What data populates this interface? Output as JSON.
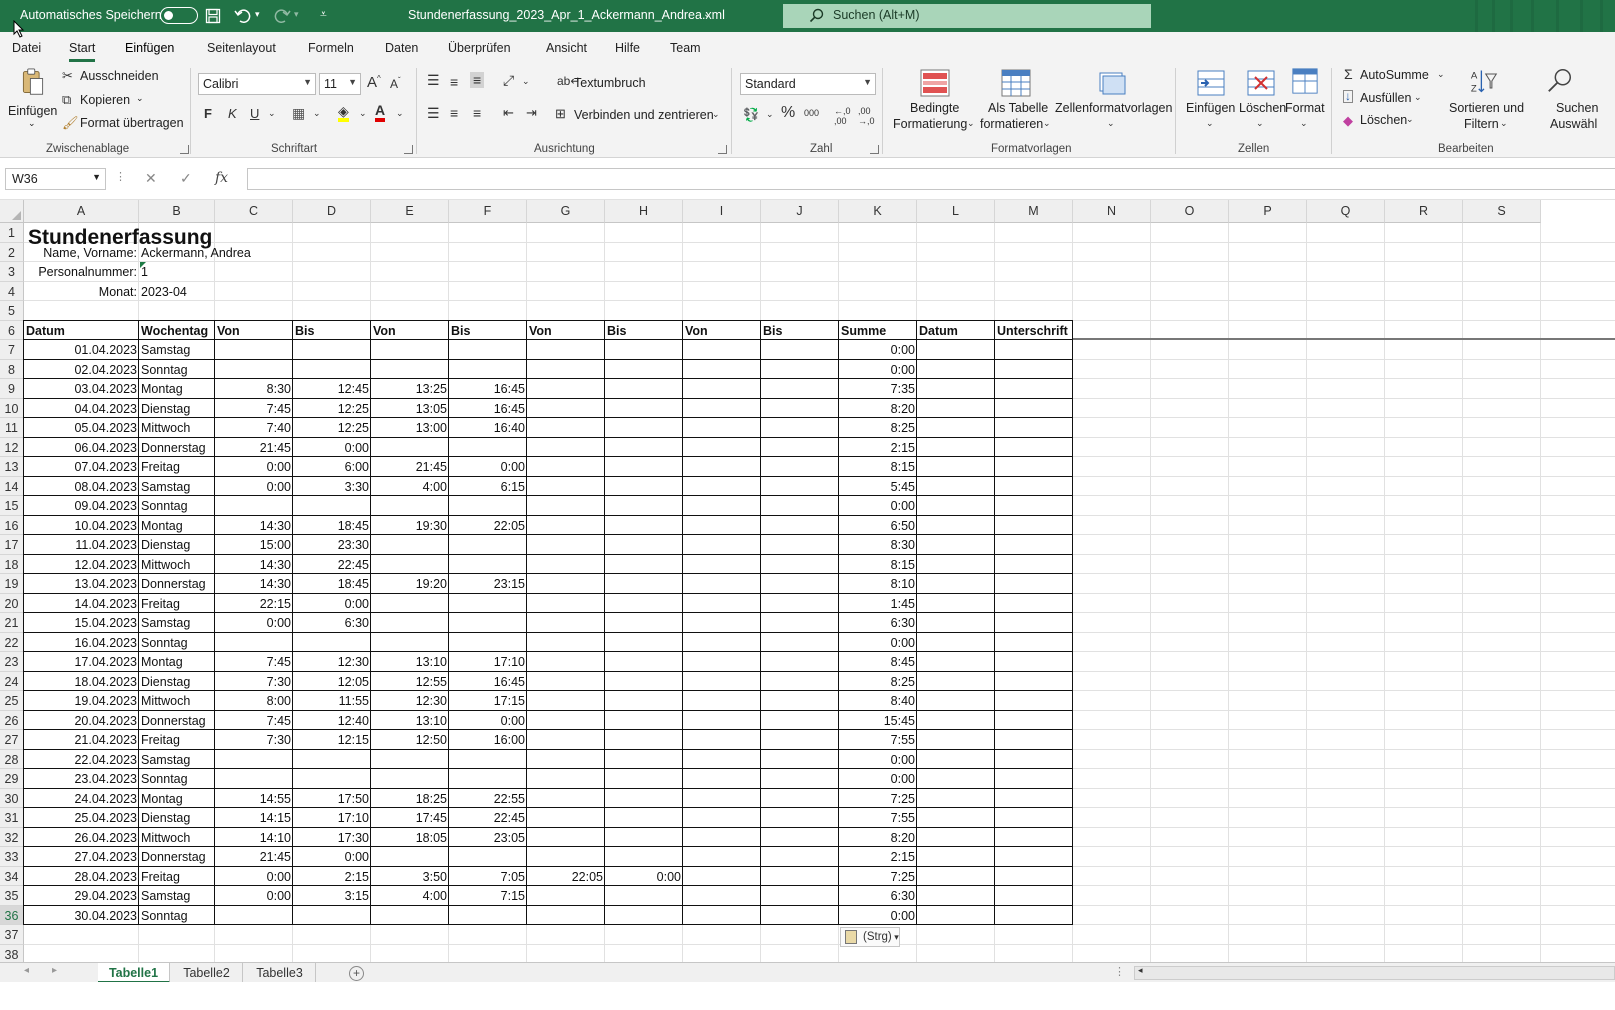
{
  "titlebar": {
    "autosave_label": "Automatisches Speichern",
    "file_title": "Stundenerfassung_2023_Apr_1_Ackermann_Andrea.xml",
    "search_placeholder": "Suchen (Alt+M)"
  },
  "menu_tabs": [
    "Datei",
    "Start",
    "Einfügen",
    "Seitenlayout",
    "Formeln",
    "Daten",
    "Überprüfen",
    "Ansicht",
    "Hilfe",
    "Team"
  ],
  "menu_active": "Start",
  "ribbon": {
    "clipboard": {
      "paste": "Einfügen",
      "cut": "Ausschneiden",
      "copy": "Kopieren",
      "format_painter": "Format übertragen",
      "group": "Zwischenablage"
    },
    "font": {
      "name": "Calibri",
      "size": "11",
      "bold": "F",
      "italic": "K",
      "underline": "U",
      "group": "Schriftart"
    },
    "alignment": {
      "wrap": "Textumbruch",
      "merge": "Verbinden und zentrieren",
      "group": "Ausrichtung"
    },
    "number": {
      "format": "Standard",
      "group": "Zahl"
    },
    "styles": {
      "conditional_1": "Bedingte",
      "conditional_2": "Formatierung",
      "table_1": "Als Tabelle",
      "table_2": "formatieren",
      "cell_styles": "Zellenformatvorlagen",
      "group": "Formatvorlagen"
    },
    "cells": {
      "insert": "Einfügen",
      "delete": "Löschen",
      "format": "Format",
      "group": "Zellen"
    },
    "editing": {
      "autosum": "AutoSumme",
      "fill": "Ausfüllen",
      "clear": "Löschen",
      "sort_1": "Sortieren und",
      "sort_2": "Filtern",
      "find_1": "Suchen",
      "find_2": "Auswähl",
      "group": "Bearbeiten"
    }
  },
  "formula_bar": {
    "name_box": "W36",
    "formula": ""
  },
  "columns": [
    "A",
    "B",
    "C",
    "D",
    "E",
    "F",
    "G",
    "H",
    "I",
    "J",
    "K",
    "L",
    "M",
    "N",
    "O",
    "P",
    "Q",
    "R",
    "S"
  ],
  "sheet": {
    "title": "Stundenerfassung",
    "name_label": "Name, Vorname:",
    "name_value": "Ackermann, Andrea",
    "pnr_label": "Personalnummer:",
    "pnr_value": "1",
    "month_label": "Monat:",
    "month_value": "2023-04",
    "headers": [
      "Datum",
      "Wochentag",
      "Von",
      "Bis",
      "Von",
      "Bis",
      "Von",
      "Bis",
      "Von",
      "Bis",
      "Summe",
      "Datum",
      "Unterschrift"
    ],
    "rows": [
      [
        "01.04.2023",
        "Samstag",
        "",
        "",
        "",
        "",
        "",
        "",
        "",
        "",
        "0:00"
      ],
      [
        "02.04.2023",
        "Sonntag",
        "",
        "",
        "",
        "",
        "",
        "",
        "",
        "",
        "0:00"
      ],
      [
        "03.04.2023",
        "Montag",
        "8:30",
        "12:45",
        "13:25",
        "16:45",
        "",
        "",
        "",
        "",
        "7:35"
      ],
      [
        "04.04.2023",
        "Dienstag",
        "7:45",
        "12:25",
        "13:05",
        "16:45",
        "",
        "",
        "",
        "",
        "8:20"
      ],
      [
        "05.04.2023",
        "Mittwoch",
        "7:40",
        "12:25",
        "13:00",
        "16:40",
        "",
        "",
        "",
        "",
        "8:25"
      ],
      [
        "06.04.2023",
        "Donnerstag",
        "21:45",
        "0:00",
        "",
        "",
        "",
        "",
        "",
        "",
        "2:15"
      ],
      [
        "07.04.2023",
        "Freitag",
        "0:00",
        "6:00",
        "21:45",
        "0:00",
        "",
        "",
        "",
        "",
        "8:15"
      ],
      [
        "08.04.2023",
        "Samstag",
        "0:00",
        "3:30",
        "4:00",
        "6:15",
        "",
        "",
        "",
        "",
        "5:45"
      ],
      [
        "09.04.2023",
        "Sonntag",
        "",
        "",
        "",
        "",
        "",
        "",
        "",
        "",
        "0:00"
      ],
      [
        "10.04.2023",
        "Montag",
        "14:30",
        "18:45",
        "19:30",
        "22:05",
        "",
        "",
        "",
        "",
        "6:50"
      ],
      [
        "11.04.2023",
        "Dienstag",
        "15:00",
        "23:30",
        "",
        "",
        "",
        "",
        "",
        "",
        "8:30"
      ],
      [
        "12.04.2023",
        "Mittwoch",
        "14:30",
        "22:45",
        "",
        "",
        "",
        "",
        "",
        "",
        "8:15"
      ],
      [
        "13.04.2023",
        "Donnerstag",
        "14:30",
        "18:45",
        "19:20",
        "23:15",
        "",
        "",
        "",
        "",
        "8:10"
      ],
      [
        "14.04.2023",
        "Freitag",
        "22:15",
        "0:00",
        "",
        "",
        "",
        "",
        "",
        "",
        "1:45"
      ],
      [
        "15.04.2023",
        "Samstag",
        "0:00",
        "6:30",
        "",
        "",
        "",
        "",
        "",
        "",
        "6:30"
      ],
      [
        "16.04.2023",
        "Sonntag",
        "",
        "",
        "",
        "",
        "",
        "",
        "",
        "",
        "0:00"
      ],
      [
        "17.04.2023",
        "Montag",
        "7:45",
        "12:30",
        "13:10",
        "17:10",
        "",
        "",
        "",
        "",
        "8:45"
      ],
      [
        "18.04.2023",
        "Dienstag",
        "7:30",
        "12:05",
        "12:55",
        "16:45",
        "",
        "",
        "",
        "",
        "8:25"
      ],
      [
        "19.04.2023",
        "Mittwoch",
        "8:00",
        "11:55",
        "12:30",
        "17:15",
        "",
        "",
        "",
        "",
        "8:40"
      ],
      [
        "20.04.2023",
        "Donnerstag",
        "7:45",
        "12:40",
        "13:10",
        "0:00",
        "",
        "",
        "",
        "",
        "15:45"
      ],
      [
        "21.04.2023",
        "Freitag",
        "7:30",
        "12:15",
        "12:50",
        "16:00",
        "",
        "",
        "",
        "",
        "7:55"
      ],
      [
        "22.04.2023",
        "Samstag",
        "",
        "",
        "",
        "",
        "",
        "",
        "",
        "",
        "0:00"
      ],
      [
        "23.04.2023",
        "Sonntag",
        "",
        "",
        "",
        "",
        "",
        "",
        "",
        "",
        "0:00"
      ],
      [
        "24.04.2023",
        "Montag",
        "14:55",
        "17:50",
        "18:25",
        "22:55",
        "",
        "",
        "",
        "",
        "7:25"
      ],
      [
        "25.04.2023",
        "Dienstag",
        "14:15",
        "17:10",
        "17:45",
        "22:45",
        "",
        "",
        "",
        "",
        "7:55"
      ],
      [
        "26.04.2023",
        "Mittwoch",
        "14:10",
        "17:30",
        "18:05",
        "23:05",
        "",
        "",
        "",
        "",
        "8:20"
      ],
      [
        "27.04.2023",
        "Donnerstag",
        "21:45",
        "0:00",
        "",
        "",
        "",
        "",
        "",
        "",
        "2:15"
      ],
      [
        "28.04.2023",
        "Freitag",
        "0:00",
        "2:15",
        "3:50",
        "7:05",
        "22:05",
        "0:00",
        "",
        "",
        "7:25"
      ],
      [
        "29.04.2023",
        "Samstag",
        "0:00",
        "3:15",
        "4:00",
        "7:15",
        "",
        "",
        "",
        "",
        "6:30"
      ],
      [
        "30.04.2023",
        "Sonntag",
        "",
        "",
        "",
        "",
        "",
        "",
        "",
        "",
        "0:00"
      ]
    ]
  },
  "paste_options": "(Strg)",
  "sheet_tabs": [
    "Tabelle1",
    "Tabelle2",
    "Tabelle3"
  ],
  "active_sheet": "Tabelle1",
  "selected_row": "36",
  "colors": {
    "accent": "#217346",
    "search_box": "#a9d5b9"
  }
}
